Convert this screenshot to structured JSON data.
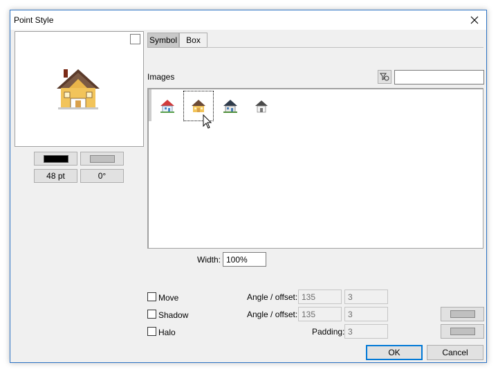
{
  "window": {
    "title": "Point Style"
  },
  "left_panel": {
    "size_label": "48 pt",
    "angle_label": "0°",
    "color1": "#000000",
    "color2": "#c0c0c0"
  },
  "tabs": [
    {
      "label": "Symbol",
      "active": true
    },
    {
      "label": "Box",
      "active": false
    }
  ],
  "images_section": {
    "label": "Images",
    "search_value": "",
    "thumbnails": [
      "house-red-roof-icon",
      "house-yellow-icon",
      "house-dark-roof-icon",
      "house-grey-icon"
    ],
    "selected_index": 1
  },
  "width_field": {
    "label": "Width:",
    "value": "100%"
  },
  "options": {
    "move": {
      "label": "Move",
      "angle_label": "Angle / offset:",
      "angle": "135",
      "offset": "3"
    },
    "shadow": {
      "label": "Shadow",
      "angle_label": "Angle / offset:",
      "angle": "135",
      "offset": "3"
    },
    "halo": {
      "label": "Halo",
      "padding_label": "Padding:",
      "padding": "3"
    }
  },
  "buttons": {
    "ok": "OK",
    "cancel": "Cancel"
  }
}
